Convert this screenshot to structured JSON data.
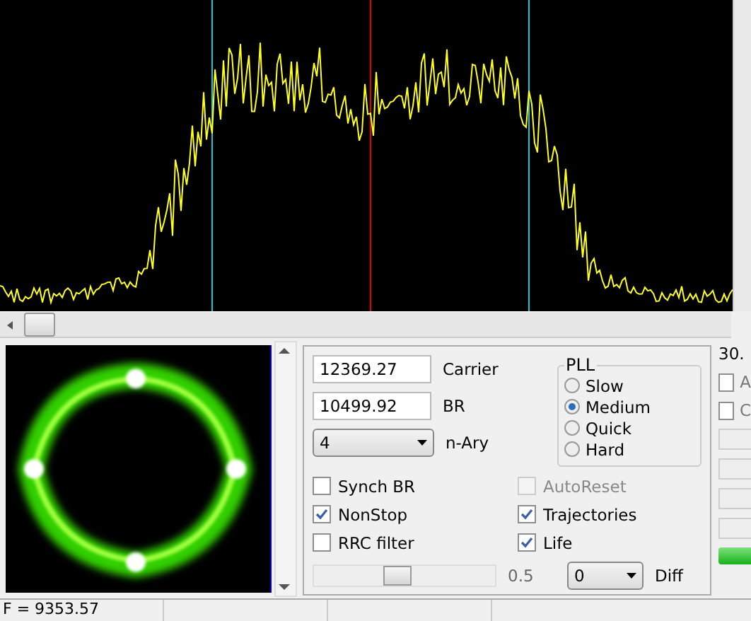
{
  "fields": [
    {
      "value": "12369.27",
      "label": "Carrier"
    },
    {
      "value": "10499.92",
      "label": "BR"
    }
  ],
  "nary": {
    "value": "4",
    "label": "n-Ary"
  },
  "pll": {
    "title": "PLL",
    "options": [
      {
        "label": "Slow",
        "selected": false
      },
      {
        "label": "Medium",
        "selected": true
      },
      {
        "label": "Quick",
        "selected": false
      },
      {
        "label": "Hard",
        "selected": false
      }
    ]
  },
  "checks_left": [
    {
      "label": "Synch BR",
      "checked": false,
      "disabled": false
    },
    {
      "label": "NonStop",
      "checked": true,
      "disabled": false
    },
    {
      "label": "RRC filter",
      "checked": false,
      "disabled": false
    }
  ],
  "checks_right": [
    {
      "label": "AutoReset",
      "checked": false,
      "disabled": true
    },
    {
      "label": "Trajectories",
      "checked": true,
      "disabled": false
    },
    {
      "label": "Life",
      "checked": true,
      "disabled": false
    }
  ],
  "slider": {
    "level": 0.45,
    "reading": "0.5"
  },
  "diff": {
    "value": "0",
    "label": "Diff"
  },
  "side": {
    "reading": "30.",
    "level": 1,
    "checks": [
      {
        "label": "A",
        "checked": false
      },
      {
        "label": "C",
        "checked": false
      }
    ]
  },
  "status": [
    "F = 9353.57"
  ]
}
